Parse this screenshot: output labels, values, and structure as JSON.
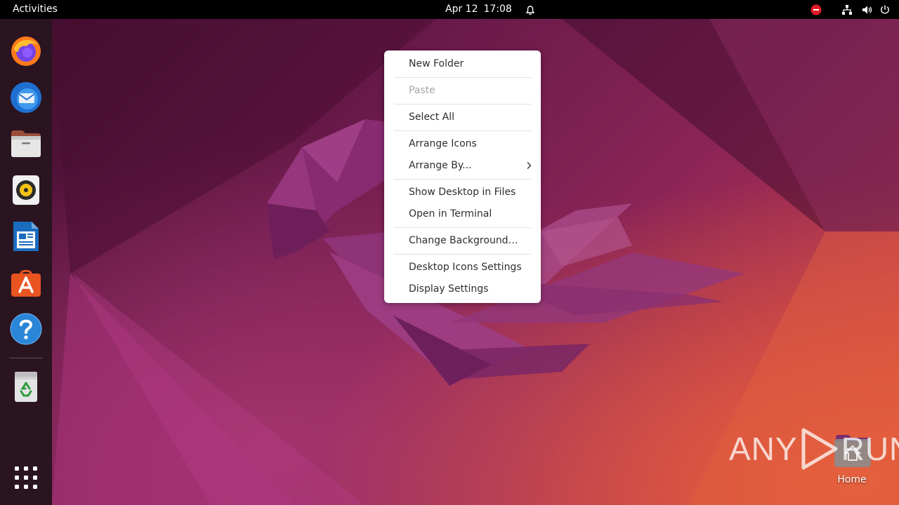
{
  "topbar": {
    "activities_label": "Activities",
    "date": "Apr 12",
    "time": "17:08"
  },
  "dock": {
    "apps": [
      {
        "name": "Firefox",
        "icon": "firefox-icon"
      },
      {
        "name": "Thunderbird",
        "icon": "thunderbird-icon"
      },
      {
        "name": "Files",
        "icon": "files-icon"
      },
      {
        "name": "Rhythmbox",
        "icon": "rhythmbox-icon"
      },
      {
        "name": "LibreOffice Writer",
        "icon": "writer-icon"
      },
      {
        "name": "Ubuntu Software",
        "icon": "software-icon"
      },
      {
        "name": "Help",
        "icon": "help-icon"
      },
      {
        "name": "Trash",
        "icon": "trash-icon"
      },
      {
        "name": "Show Applications",
        "icon": "app-grid-icon"
      }
    ]
  },
  "context_menu": {
    "items": {
      "new_folder": "New Folder",
      "paste": "Paste",
      "select_all": "Select All",
      "arrange_icons": "Arrange Icons",
      "arrange_by": "Arrange By...",
      "show_desktop_in_files": "Show Desktop in Files",
      "open_in_terminal": "Open in Terminal",
      "change_background": "Change Background…",
      "desktop_icons_settings": "Desktop Icons Settings",
      "display_settings": "Display Settings"
    },
    "paste_enabled": false
  },
  "desktop": {
    "home_label": "Home"
  },
  "watermark": {
    "left": "ANY",
    "right": "RUN"
  },
  "colors": {
    "topbar_bg": "#000000",
    "dock_bg": "#2a1420",
    "menu_bg": "#ffffff",
    "menu_text": "#2e2e2e",
    "menu_disabled": "#a6a6a6",
    "dnd_red": "#e01b24"
  }
}
